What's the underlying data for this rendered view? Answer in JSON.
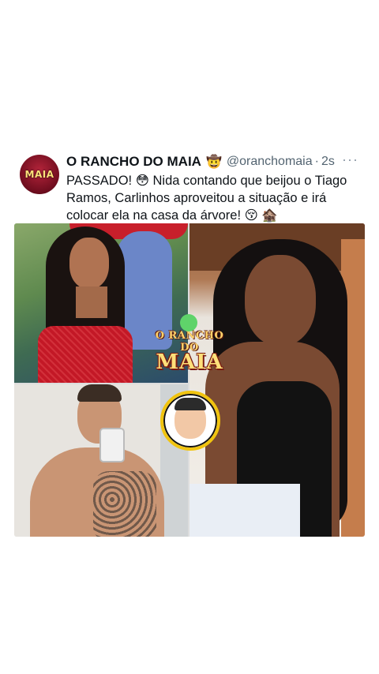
{
  "tweet": {
    "author_name": "O RANCHO DO MAIA",
    "author_badge": "🤠",
    "handle": "@oranchomaia",
    "separator": "·",
    "time": "2s",
    "more_label": "···",
    "text": "PASSADO! 😳 Nida contando que beijou o Tiago Ramos, Carlinhos aproveitou a situação e irá colocar ela na casa da árvore! 😚 🏚️"
  },
  "avatar": {
    "logo_text": "MAIA"
  },
  "media": {
    "watermark_top": "O RANCHO DO",
    "watermark_main": "MAIA"
  },
  "icons": {
    "more": "more-horizontal-icon",
    "badge": "cowboy-emoji-icon"
  },
  "colors": {
    "text": "#0f1419",
    "muted": "#536471",
    "background": "#ffffff"
  }
}
